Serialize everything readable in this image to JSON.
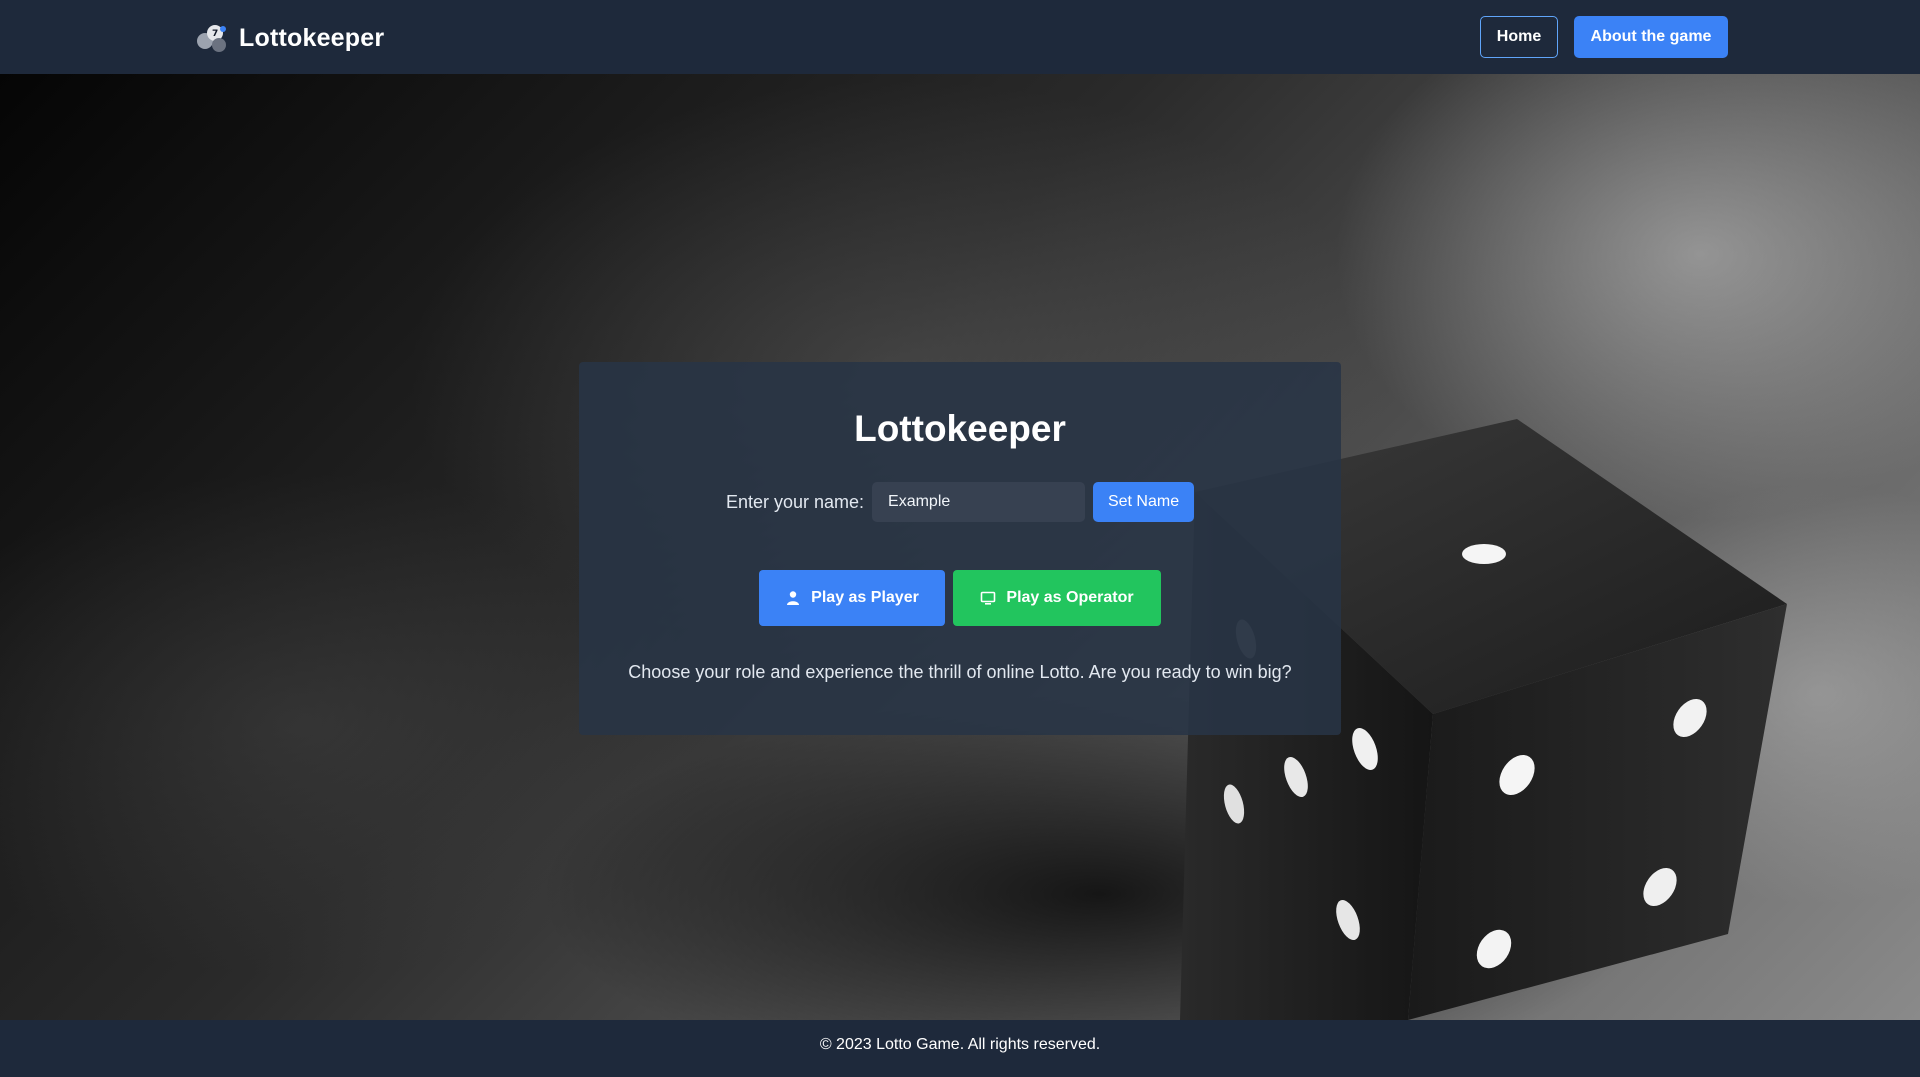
{
  "navbar": {
    "brand_name": "Lottokeeper",
    "logo_icon": "lotto-balls-logo",
    "home_label": "Home",
    "about_label": "About the game"
  },
  "card": {
    "title": "Lottokeeper",
    "name_label": "Enter your name:",
    "name_value": "Example",
    "set_name_label": "Set Name",
    "player_label": "Play as Player",
    "player_icon": "user-icon",
    "operator_label": "Play as Operator",
    "operator_icon": "monitor-icon",
    "tagline": "Choose your role and experience the thrill of online Lotto. Are you ready to win big?"
  },
  "footer": {
    "text": "© 2023 Lotto Game. All rights reserved."
  },
  "colors": {
    "navbar_bg": "#1e293b",
    "primary": "#3b82f6",
    "success": "#22c55e",
    "card_bg": "#283446",
    "input_bg": "#374151"
  }
}
